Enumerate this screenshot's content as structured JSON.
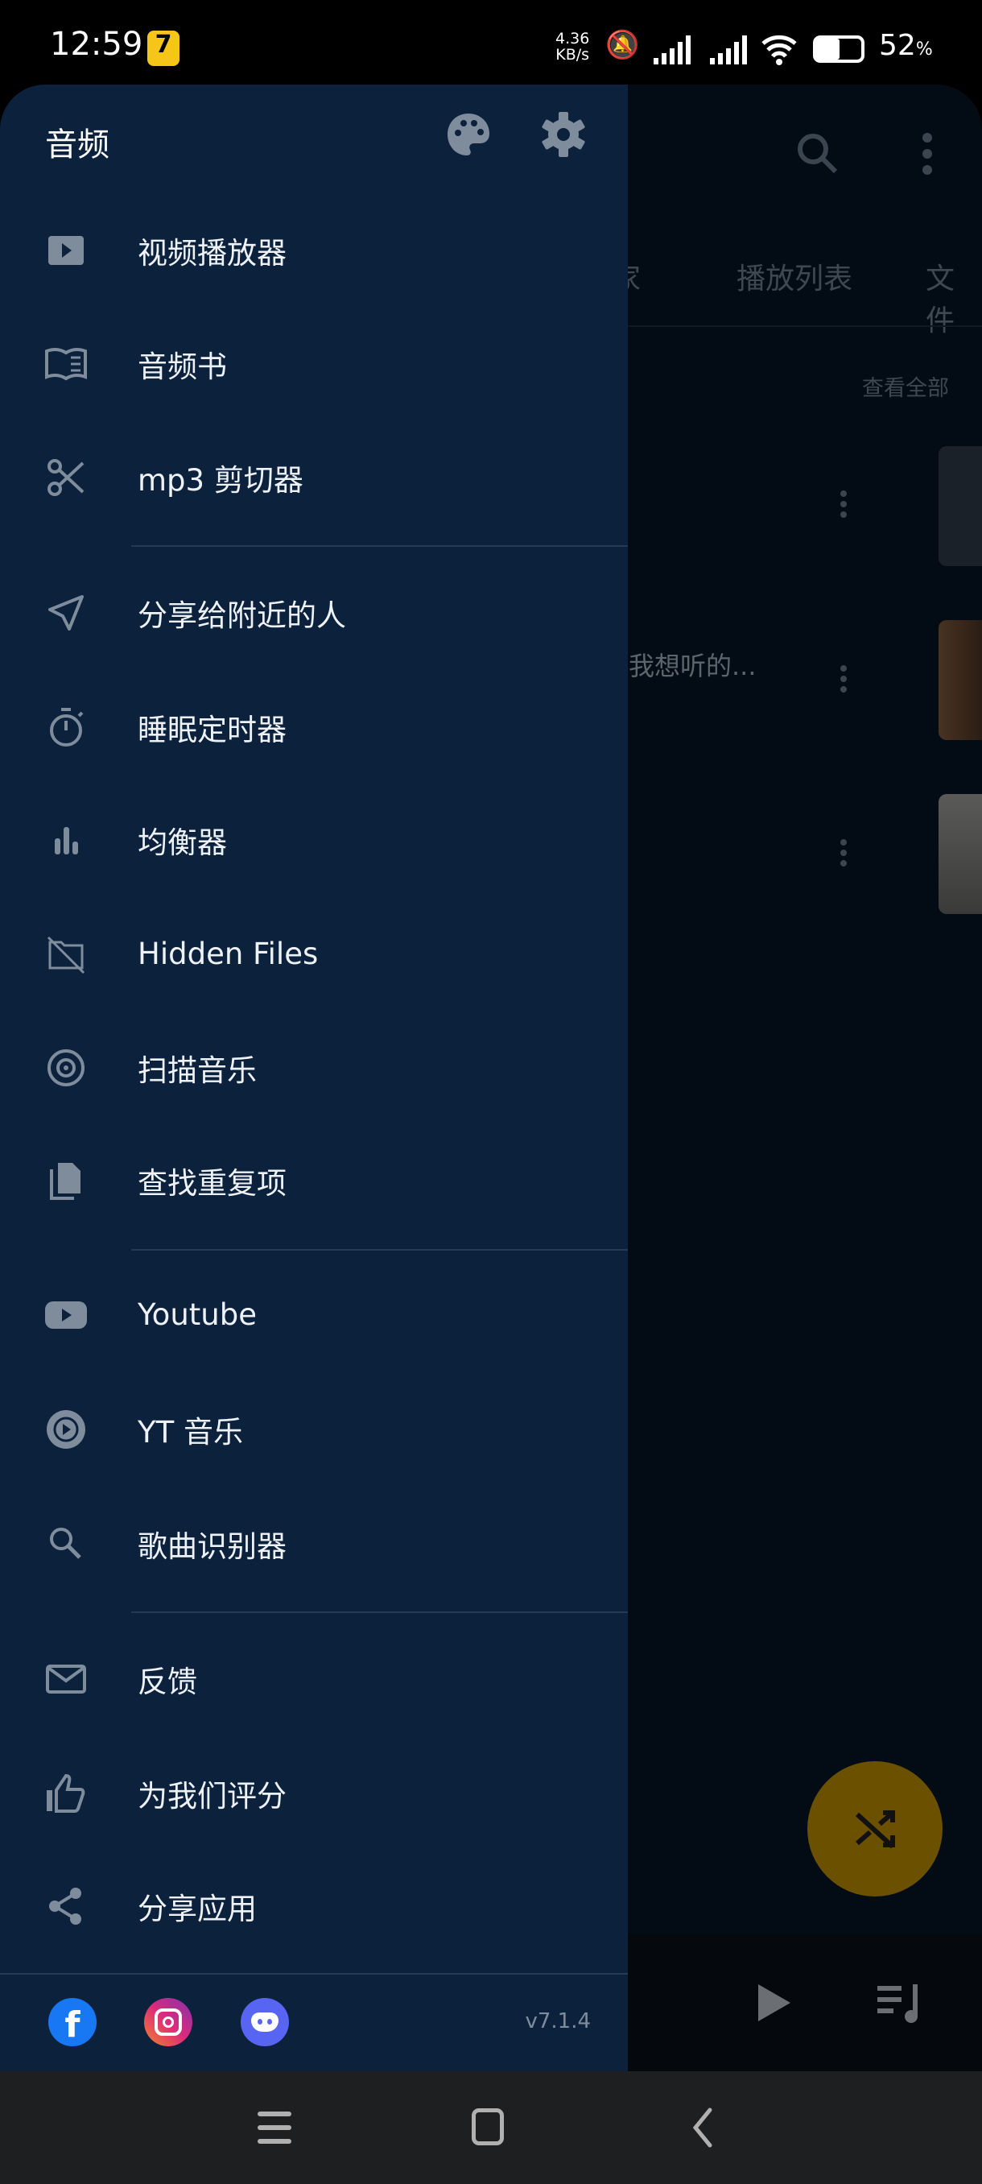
{
  "status_bar": {
    "time": "12:59",
    "net_speed": "4.36",
    "net_unit": "KB/s",
    "battery": "52",
    "battery_unit": "%",
    "battery_level": 0.52
  },
  "drawer": {
    "title": "音频",
    "header_icons": [
      "palette-icon",
      "gear-icon"
    ],
    "groups": [
      [
        {
          "label": "视频播放器",
          "icon": "video-player-icon"
        },
        {
          "label": "音频书",
          "icon": "book-icon"
        },
        {
          "label": "mp3 剪切器",
          "icon": "scissors-icon"
        }
      ],
      [
        {
          "label": "分享给附近的人",
          "icon": "send-icon"
        },
        {
          "label": "睡眠定时器",
          "icon": "timer-icon"
        },
        {
          "label": "均衡器",
          "icon": "equalizer-icon"
        },
        {
          "label": "Hidden Files",
          "icon": "hidden-folder-icon"
        },
        {
          "label": "扫描音乐",
          "icon": "scan-icon"
        },
        {
          "label": "查找重复项",
          "icon": "duplicate-icon"
        }
      ],
      [
        {
          "label": "Youtube",
          "icon": "youtube-icon"
        },
        {
          "label": "YT 音乐",
          "icon": "yt-music-icon"
        },
        {
          "label": "歌曲识别器",
          "icon": "search-icon"
        }
      ],
      [
        {
          "label": "反馈",
          "icon": "mail-icon"
        },
        {
          "label": "为我们评分",
          "icon": "thumbs-up-icon"
        },
        {
          "label": "分享应用",
          "icon": "share-icon"
        }
      ]
    ],
    "footer": {
      "social": [
        "facebook-icon",
        "instagram-icon",
        "discord-icon"
      ],
      "version": "v7.1.4"
    }
  },
  "background": {
    "tabs": [
      "家",
      "播放列表",
      "文件"
    ],
    "view_all": "查看全部",
    "list_text": "我想听的...",
    "fab_icon": "shuffle-icon",
    "fab_color": "#6b5000"
  },
  "colors": {
    "drawer_bg": "#0b213c",
    "icon": "#7e8c9c",
    "overlay_bg": "#030b14"
  }
}
